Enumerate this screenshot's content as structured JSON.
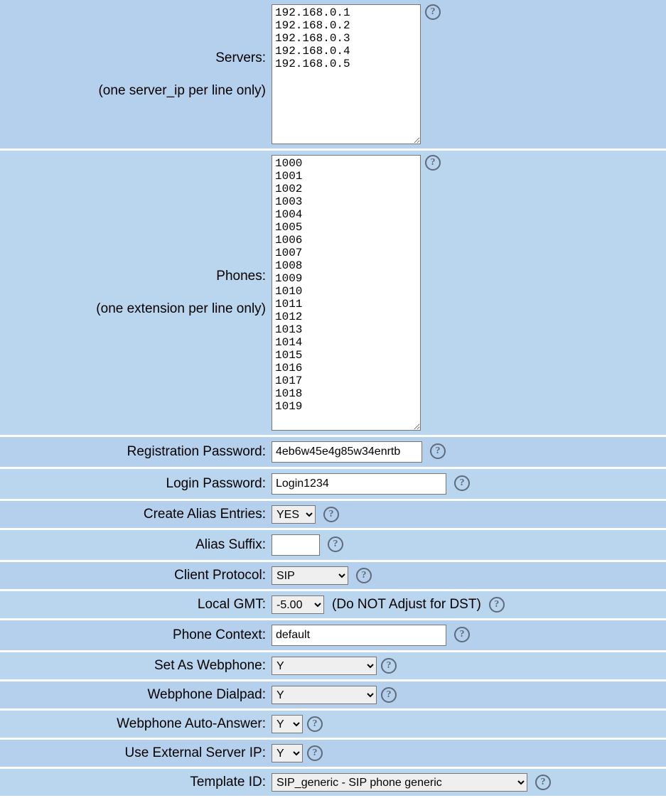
{
  "rows": {
    "servers": {
      "label_main": "Servers:",
      "label_sub": "(one server_ip per line only)",
      "value": "192.168.0.1\n192.168.0.2\n192.168.0.3\n192.168.0.4\n192.168.0.5"
    },
    "phones": {
      "label_main": "Phones:",
      "label_sub": "(one extension per line only)",
      "value": "1000\n1001\n1002\n1003\n1004\n1005\n1006\n1007\n1008\n1009\n1010\n1011\n1012\n1013\n1014\n1015\n1016\n1017\n1018\n1019"
    },
    "reg_password": {
      "label": "Registration Password:",
      "value": "4eb6w45e4g85w34enrtb"
    },
    "login_password": {
      "label": "Login Password:",
      "value": "Login1234"
    },
    "create_alias": {
      "label": "Create Alias Entries:",
      "selected": "YES"
    },
    "alias_suffix": {
      "label": "Alias Suffix:",
      "value": ""
    },
    "client_protocol": {
      "label": "Client Protocol:",
      "selected": "SIP"
    },
    "local_gmt": {
      "label": "Local GMT:",
      "selected": "-5.00",
      "note": "(Do NOT Adjust for DST)"
    },
    "phone_context": {
      "label": "Phone Context:",
      "value": "default"
    },
    "set_as_webphone": {
      "label": "Set As Webphone:",
      "selected": "Y"
    },
    "webphone_dialpad": {
      "label": "Webphone Dialpad:",
      "selected": "Y"
    },
    "webphone_auto_answer": {
      "label": "Webphone Auto-Answer:",
      "selected": "Y"
    },
    "use_external_server_ip": {
      "label": "Use External Server IP:",
      "selected": "Y"
    },
    "template_id": {
      "label": "Template ID:",
      "selected": "SIP_generic - SIP phone generic"
    }
  },
  "help_glyph": "?"
}
